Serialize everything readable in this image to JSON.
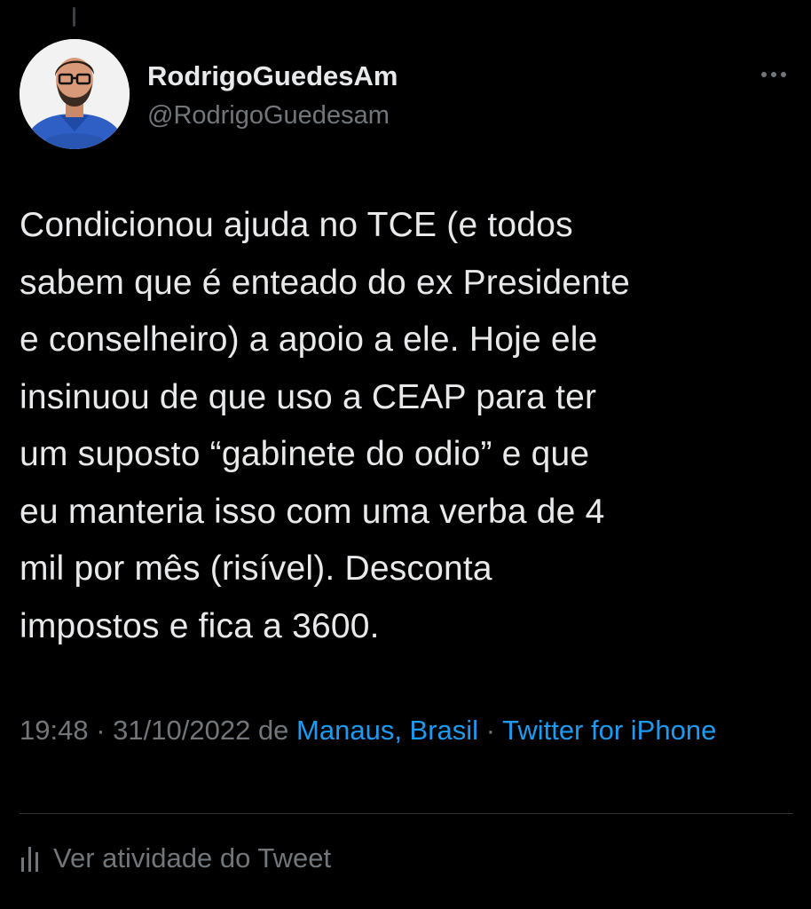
{
  "colors": {
    "background": "#000000",
    "text_primary": "#e7e9ea",
    "text_secondary": "#71767b",
    "link": "#1d9bf0",
    "divider": "#2f3336"
  },
  "author": {
    "display_name": "RodrigoGuedesAm",
    "handle": "@RodrigoGuedesam",
    "avatar_icon": "profile-photo"
  },
  "more_icon": "ellipsis-icon",
  "tweet": {
    "text": "Condicionou ajuda no TCE (e todos\nsabem que é enteado do ex Presidente\ne conselheiro) a apoio a ele. Hoje ele\ninsinuou de que uso a CEAP para ter\num suposto “gabinete do odio” e que\neu manteria isso com uma verba de 4\nmil por mês (risível). Desconta\nimpostos e fica a 3600."
  },
  "meta": {
    "time": "19:48",
    "separator": "·",
    "date": "31/10/2022",
    "from_word": "de",
    "location": "Manaus, Brasil",
    "source": "Twitter for iPhone"
  },
  "activity": {
    "icon": "analytics-icon",
    "label": "Ver atividade do Tweet"
  }
}
